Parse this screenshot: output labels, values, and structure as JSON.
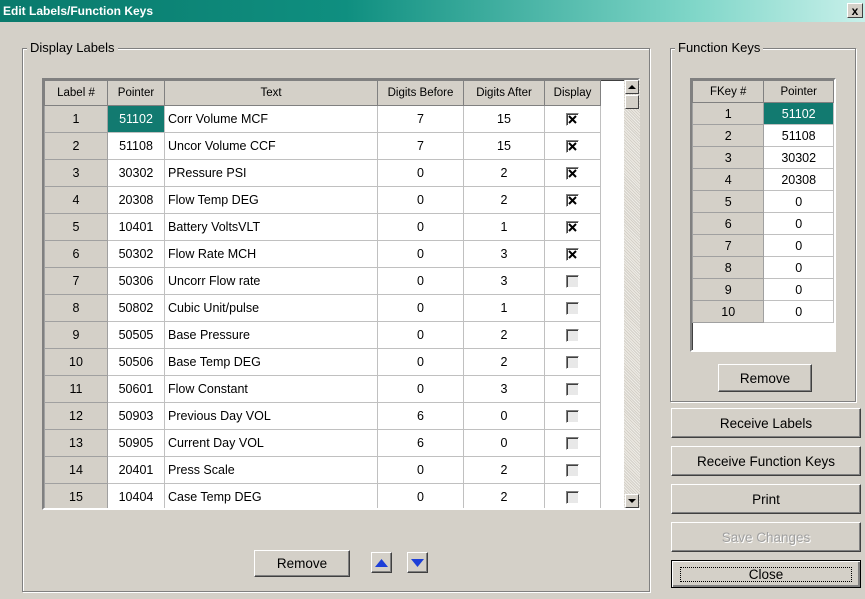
{
  "window": {
    "title": "Edit Labels/Function Keys",
    "close_glyph": "x"
  },
  "display_labels": {
    "legend": "Display Labels",
    "columns": [
      "Label #",
      "Pointer",
      "Text",
      "Digits Before",
      "Digits After",
      "Display"
    ],
    "rows": [
      {
        "label": "1",
        "pointer": "51102",
        "text": "Corr Volume MCF",
        "before": "7",
        "after": "15",
        "display": true
      },
      {
        "label": "2",
        "pointer": "51108",
        "text": "Uncor Volume CCF",
        "before": "7",
        "after": "15",
        "display": true
      },
      {
        "label": "3",
        "pointer": "30302",
        "text": "PRessure PSI",
        "before": "0",
        "after": "2",
        "display": true
      },
      {
        "label": "4",
        "pointer": "20308",
        "text": "Flow Temp DEG",
        "before": "0",
        "after": "2",
        "display": true
      },
      {
        "label": "5",
        "pointer": "10401",
        "text": "Battery VoltsVLT",
        "before": "0",
        "after": "1",
        "display": true
      },
      {
        "label": "6",
        "pointer": "50302",
        "text": "Flow Rate MCH",
        "before": "0",
        "after": "3",
        "display": true
      },
      {
        "label": "7",
        "pointer": "50306",
        "text": "Uncorr Flow rate",
        "before": "0",
        "after": "3",
        "display": false
      },
      {
        "label": "8",
        "pointer": "50802",
        "text": "Cubic Unit/pulse",
        "before": "0",
        "after": "1",
        "display": false
      },
      {
        "label": "9",
        "pointer": "50505",
        "text": "Base Pressure",
        "before": "0",
        "after": "2",
        "display": false
      },
      {
        "label": "10",
        "pointer": "50506",
        "text": "Base Temp DEG",
        "before": "0",
        "after": "2",
        "display": false
      },
      {
        "label": "11",
        "pointer": "50601",
        "text": "Flow Constant",
        "before": "0",
        "after": "3",
        "display": false
      },
      {
        "label": "12",
        "pointer": "50903",
        "text": "Previous Day VOL",
        "before": "6",
        "after": "0",
        "display": false
      },
      {
        "label": "13",
        "pointer": "50905",
        "text": "Current Day VOL",
        "before": "6",
        "after": "0",
        "display": false
      },
      {
        "label": "14",
        "pointer": "20401",
        "text": "Press Scale",
        "before": "0",
        "after": "2",
        "display": false
      },
      {
        "label": "15",
        "pointer": "10404",
        "text": "Case Temp DEG",
        "before": "0",
        "after": "2",
        "display": false
      }
    ],
    "remove_label": "Remove",
    "move_up_icon": "arrow-up-icon",
    "move_down_icon": "arrow-down-icon"
  },
  "function_keys": {
    "legend": "Function Keys",
    "columns": [
      "FKey #",
      "Pointer"
    ],
    "rows": [
      {
        "key": "1",
        "pointer": "51102"
      },
      {
        "key": "2",
        "pointer": "51108"
      },
      {
        "key": "3",
        "pointer": "30302"
      },
      {
        "key": "4",
        "pointer": "20308"
      },
      {
        "key": "5",
        "pointer": "0"
      },
      {
        "key": "6",
        "pointer": "0"
      },
      {
        "key": "7",
        "pointer": "0"
      },
      {
        "key": "8",
        "pointer": "0"
      },
      {
        "key": "9",
        "pointer": "0"
      },
      {
        "key": "10",
        "pointer": "0"
      }
    ],
    "remove_label": "Remove"
  },
  "actions": {
    "receive_labels": "Receive Labels",
    "receive_function_keys": "Receive Function Keys",
    "print": "Print",
    "save_changes": "Save Changes",
    "close": "Close"
  },
  "colors": {
    "selected_cell": "#127a70",
    "title_gradient_start": "#0a7a6c",
    "arrow_blue": "#1d3fd8"
  }
}
